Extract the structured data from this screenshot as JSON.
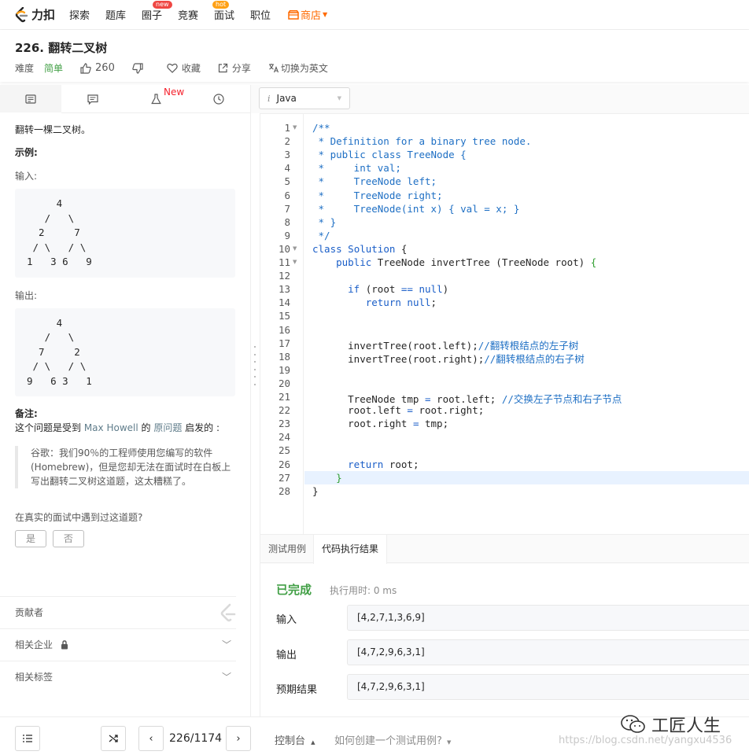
{
  "nav": {
    "logo_text": "力扣",
    "items": [
      {
        "label": "探索"
      },
      {
        "label": "题库"
      },
      {
        "label": "圈子",
        "badge": "new"
      },
      {
        "label": "竞赛",
        "badge": "hot"
      },
      {
        "label": "面试"
      },
      {
        "label": "职位"
      }
    ],
    "shop_label": "商店"
  },
  "question": {
    "title": "226. 翻转二叉树",
    "difficulty_label": "难度",
    "difficulty": "简单",
    "likes": "260",
    "favorite": "收藏",
    "share": "分享",
    "switch_lang": "切换为英文"
  },
  "left_tabs": {
    "new_tag": "New"
  },
  "description": {
    "intro": "翻转一棵二叉树。",
    "example_label": "示例:",
    "input_label": "输入:",
    "input_tree": "     4\n   /   \\\n  2     7\n / \\   / \\\n1   3 6   9",
    "output_label": "输出:",
    "output_tree": "     4\n   /   \\\n  7     2\n / \\   / \\\n9   6 3   1",
    "note_label": "备注:",
    "note_prefix": "这个问题是受到 ",
    "note_link1": "Max Howell",
    "note_mid": " 的 ",
    "note_link2": "原问题",
    "note_suffix": " 启发的 :",
    "quote": "谷歌：我们90％的工程师使用您编写的软件(Homebrew)，但是您却无法在面试时在白板上写出翻转二叉树这道题，这太糟糕了。",
    "interview_q": "在真实的面试中遇到过这道题?",
    "yes": "是",
    "no": "否",
    "contributors": "贡献者",
    "companies": "相关企业",
    "tags": "相关标签"
  },
  "editor": {
    "language": "Java",
    "lines": [
      {
        "n": "1",
        "fold": true,
        "html": "<span style='color:#1e6fc4'>/**</span>"
      },
      {
        "n": "2",
        "html": "<span style='color:#1e6fc4'> * Definition for a binary tree node.</span>"
      },
      {
        "n": "3",
        "html": "<span style='color:#1e6fc4'> * public class TreeNode {</span>"
      },
      {
        "n": "4",
        "html": "<span style='color:#1e6fc4'> *     int val;</span>"
      },
      {
        "n": "5",
        "html": "<span style='color:#1e6fc4'> *     TreeNode left;</span>"
      },
      {
        "n": "6",
        "html": "<span style='color:#1e6fc4'> *     TreeNode right;</span>"
      },
      {
        "n": "7",
        "html": "<span style='color:#1e6fc4'> *     TreeNode(int x) { val = x; }</span>"
      },
      {
        "n": "8",
        "html": "<span style='color:#1e6fc4'> * }</span>"
      },
      {
        "n": "9",
        "html": "<span style='color:#1e6fc4'> */</span>"
      },
      {
        "n": "10",
        "fold": true,
        "html": "<span style='color:#1a5ec8'>class</span> <span style='color:#1a5ec8'>Solution</span> {"
      },
      {
        "n": "11",
        "fold": true,
        "html": "    <span style='color:#1a5ec8'>public</span> TreeNode invertTree (TreeNode root) <span style='color:#2f9e2f'>{</span>"
      },
      {
        "n": "12",
        "html": ""
      },
      {
        "n": "13",
        "html": "      <span style='color:#1a5ec8'>if</span> (root <span style='color:#1a5ec8'>==</span> <span style='color:#1a5ec8'>null</span>)"
      },
      {
        "n": "14",
        "html": "         <span style='color:#1a5ec8'>return</span> <span style='color:#1a5ec8'>null</span>;"
      },
      {
        "n": "15",
        "html": ""
      },
      {
        "n": "16",
        "html": ""
      },
      {
        "n": "17",
        "html": "      invertTree(root.left);<span style='color:#1e6fc4'>//翻转根结点的左子树</span>"
      },
      {
        "n": "18",
        "html": "      invertTree(root.right);<span style='color:#1e6fc4'>//翻转根结点的右子树</span>"
      },
      {
        "n": "19",
        "html": ""
      },
      {
        "n": "20",
        "html": ""
      },
      {
        "n": "21",
        "html": "      TreeNode tmp <span style='color:#1a5ec8'>=</span> root.left; <span style='color:#1e6fc4'>//交换左子节点和右子节点</span>"
      },
      {
        "n": "22",
        "html": "      root.left <span style='color:#1a5ec8'>=</span> root.right;"
      },
      {
        "n": "23",
        "html": "      root.right <span style='color:#1a5ec8'>=</span> tmp;"
      },
      {
        "n": "24",
        "html": ""
      },
      {
        "n": "25",
        "html": ""
      },
      {
        "n": "26",
        "html": "      <span style='color:#1a5ec8'>return</span> root;"
      },
      {
        "n": "27",
        "html": "    <span style='color:#2f9e2f'>}</span>"
      },
      {
        "n": "28",
        "html": "}"
      }
    ]
  },
  "console": {
    "tab_testcase": "测试用例",
    "tab_result": "代码执行结果",
    "status": "已完成",
    "exec_time": "执行用时: 0 ms",
    "input_label": "输入",
    "input_value": "[4,2,7,1,3,6,9]",
    "output_label": "输出",
    "output_value": "[4,7,2,9,6,3,1]",
    "expected_label": "预期结果",
    "expected_value": "[4,7,2,9,6,3,1]"
  },
  "bottom": {
    "pager": "226/1174",
    "console_label": "控制台",
    "howto": "如何创建一个测试用例?",
    "watermark": "工匠人生",
    "watermark_url": "https://blog.csdn.net/yangxu4536"
  }
}
